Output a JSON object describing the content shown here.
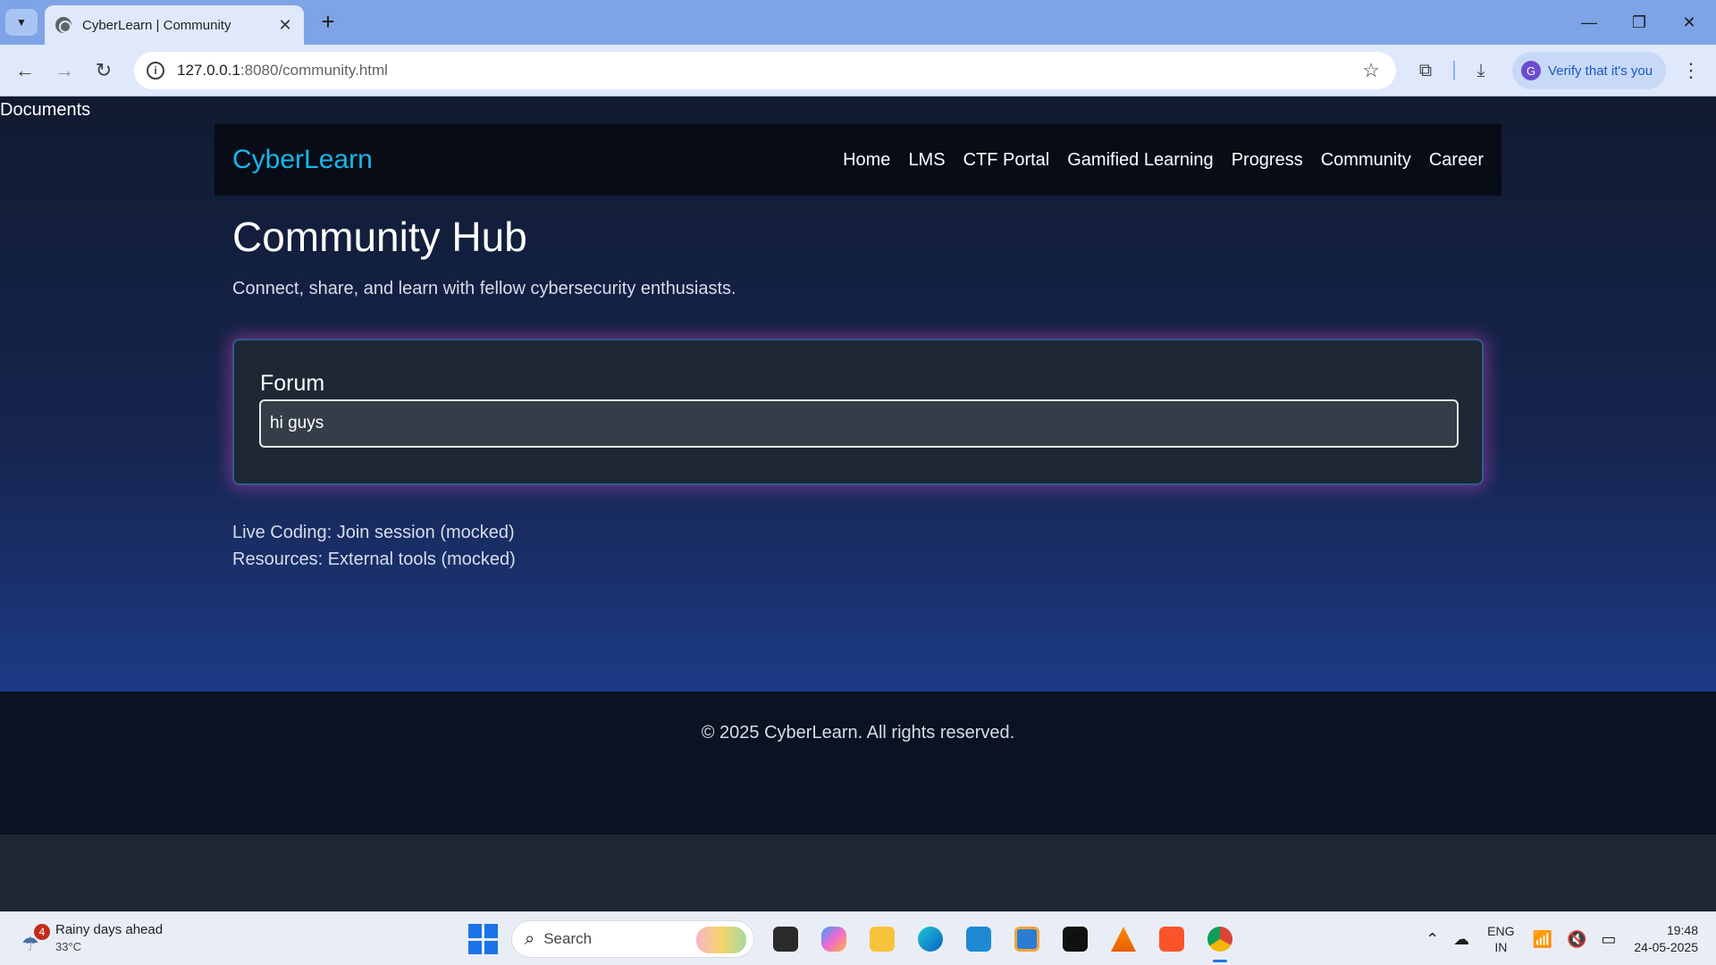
{
  "browser": {
    "tab_title": "CyberLearn | Community",
    "url_host": "127.0.0.1",
    "url_rest": ":8080/community.html",
    "profile_label": "Verify that it's you",
    "profile_initial": "G"
  },
  "page": {
    "docs_label": "Documents",
    "brand": "CyberLearn",
    "nav": [
      "Home",
      "LMS",
      "CTF Portal",
      "Gamified Learning",
      "Progress",
      "Community",
      "Career"
    ],
    "title": "Community Hub",
    "subtitle": "Connect, share, and learn with fellow cybersecurity enthusiasts.",
    "forum": {
      "label": "Forum",
      "input_value": "hi guys"
    },
    "live_coding": "Live Coding: Join session (mocked)",
    "resources": "Resources: External tools (mocked)",
    "footer": "© 2025 CyberLearn. All rights reserved."
  },
  "taskbar": {
    "weather_title": "Rainy days ahead",
    "weather_temp": "33°C",
    "weather_badge": "4",
    "search_label": "Search",
    "lang_top": "ENG",
    "lang_bottom": "IN",
    "time": "19:48",
    "date": "24-05-2025"
  },
  "colors": {
    "brand": "#18b6ea",
    "nav_bg": "#070c17",
    "card_glow": "#d246c8",
    "footer_bg": "#0b1221"
  }
}
